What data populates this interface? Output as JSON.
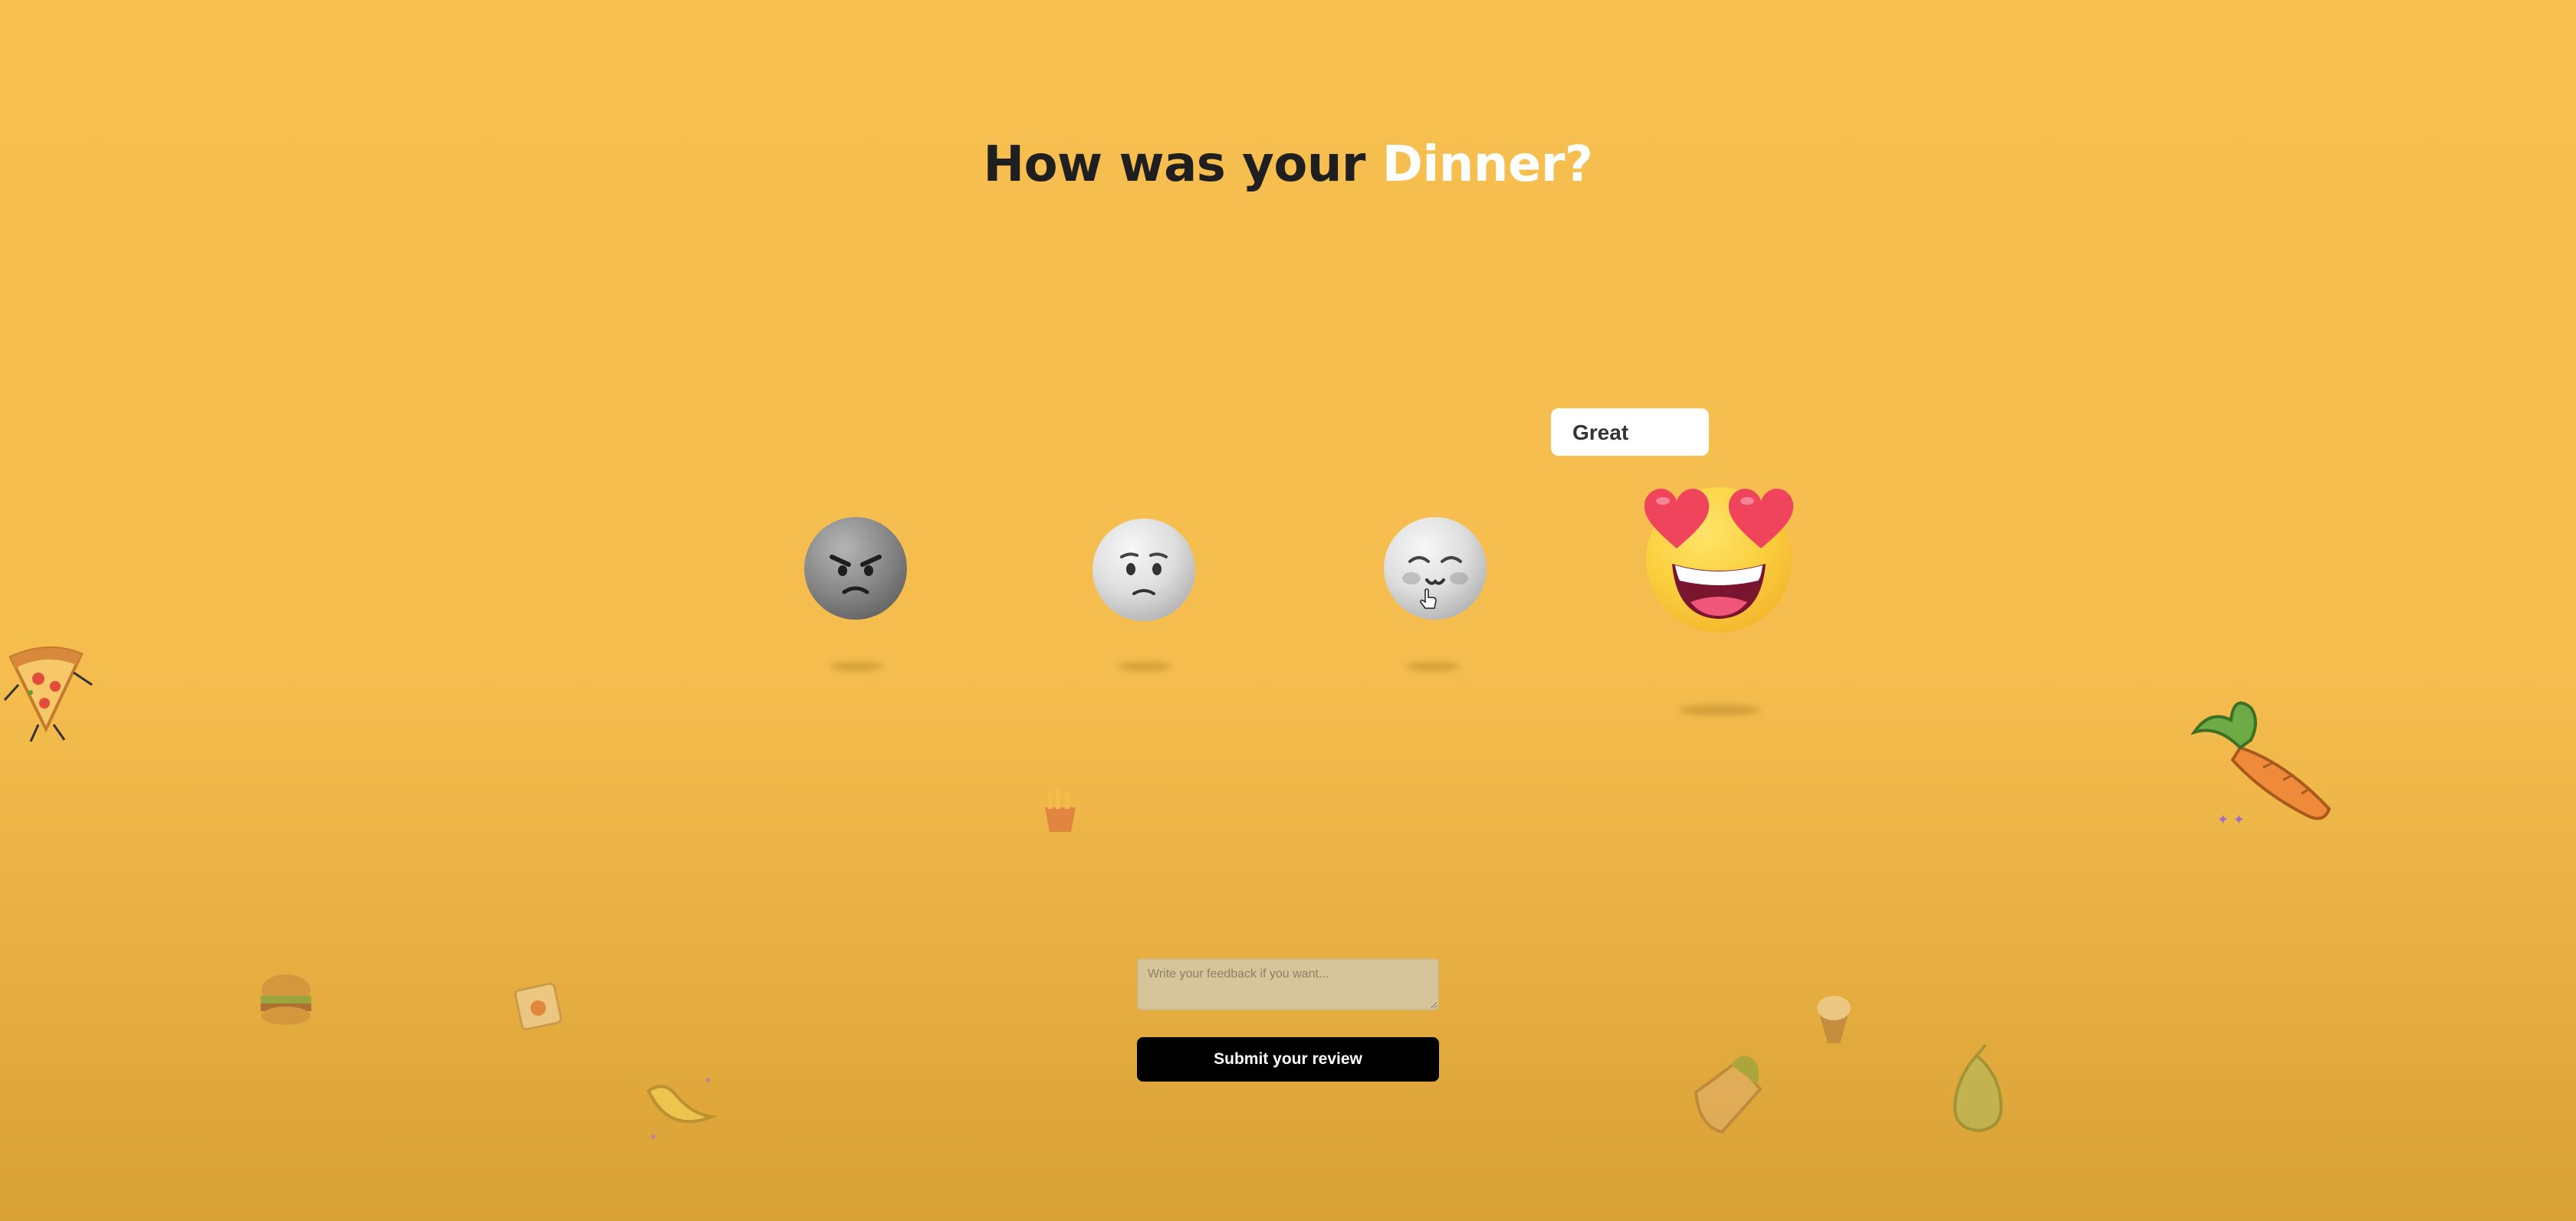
{
  "heading": {
    "prefix": "How was your ",
    "highlight": "Dinner?"
  },
  "tooltip": {
    "label": "Great"
  },
  "ratings": [
    {
      "name": "angry-emoji",
      "mood": "angry"
    },
    {
      "name": "unhappy-emoji",
      "mood": "unhappy"
    },
    {
      "name": "content-emoji",
      "mood": "content"
    },
    {
      "name": "love-eyes-emoji",
      "mood": "great",
      "selected": true
    }
  ],
  "feedback": {
    "placeholder": "Write your feedback if you want..."
  },
  "submit": {
    "label": "Submit your review"
  },
  "colors": {
    "background": "#f5bd4e",
    "accent_text": "#ffffff",
    "button": "#000000"
  }
}
